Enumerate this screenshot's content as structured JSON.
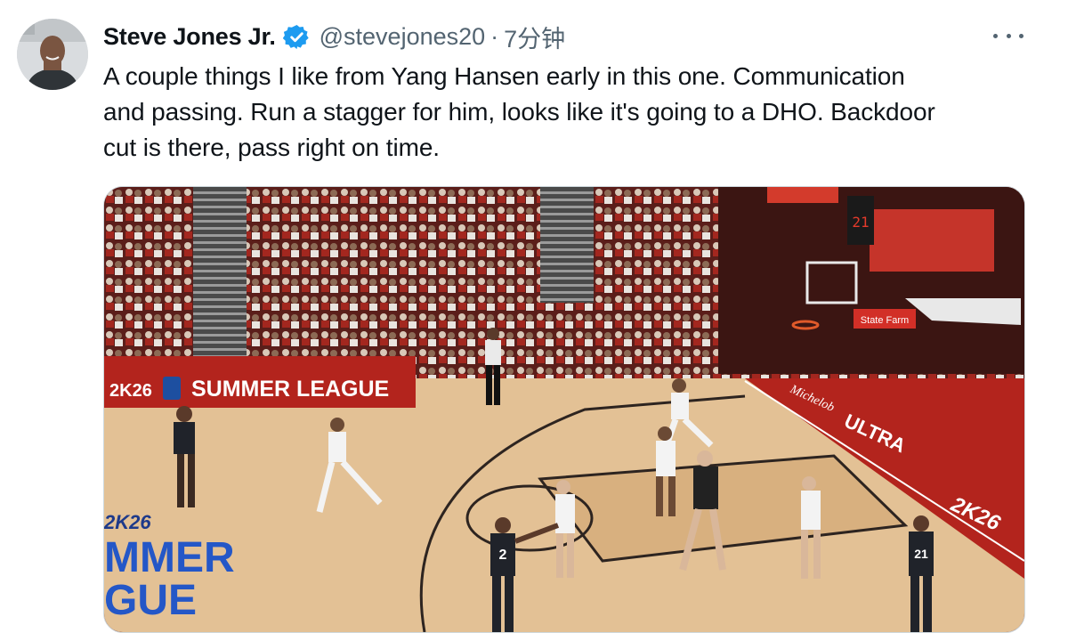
{
  "tweet": {
    "author_name": "Steve Jones Jr.",
    "handle": "@stevejones20",
    "separator": "·",
    "time": "7分钟",
    "text_lines": [
      "A couple things I like from Yang Hansen early in this one. Communication",
      "and passing. Run a stagger for him, looks like it's going to a DHO. Backdoor",
      "cut is there, pass right on time."
    ],
    "verified": true,
    "more_icon": "more-horizontal-icon"
  },
  "media": {
    "banner_brand": "2K26",
    "banner_text": "SUMMER LEAGUE",
    "court_logo_top": "2K26",
    "court_logo_text": "MMER",
    "court_logo_text2": "GUE",
    "sponsor_sign": "State Farm",
    "court_brand": "ULTRA",
    "court_script": "Michelob",
    "baseline_logo": "2K26",
    "jersey_2": "2",
    "jersey_21": "21",
    "shot_clock": "21"
  },
  "colors": {
    "accent": "#1d9bf0",
    "secondary_text": "#536471",
    "court_red": "#b3241d",
    "court_wood": "#e6c79b"
  }
}
